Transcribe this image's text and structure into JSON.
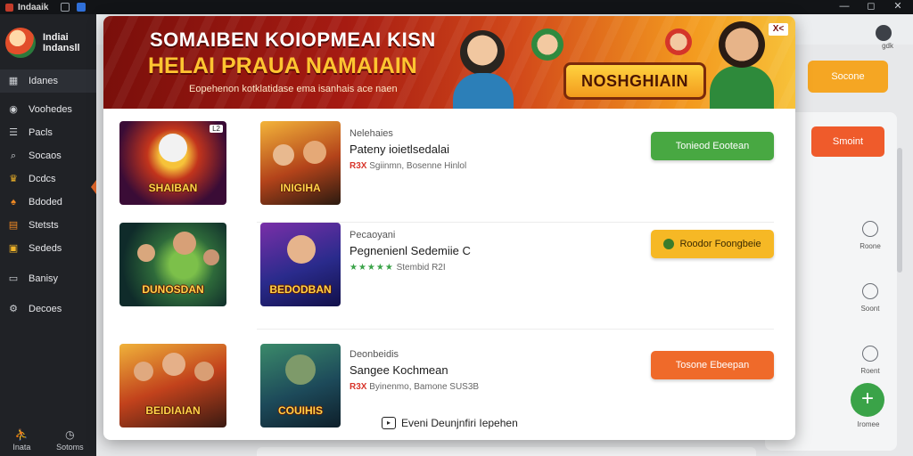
{
  "window": {
    "title": "Indaaik",
    "controls": [
      "—",
      "◻",
      "✕"
    ]
  },
  "sidebar": {
    "brand": [
      "Indiai",
      "Indansll"
    ],
    "items": [
      {
        "label": "Idanes",
        "icon": "grid-icon"
      },
      {
        "label": "Voohedes",
        "icon": "circle-icon"
      },
      {
        "label": "Pacls",
        "icon": "list-icon"
      },
      {
        "label": "Socaos",
        "icon": "search-icon"
      },
      {
        "label": "Dcdcs",
        "icon": "trophy-icon"
      },
      {
        "label": "Bdoded",
        "icon": "bell-icon"
      },
      {
        "label": "Stetsts",
        "icon": "stats-icon"
      },
      {
        "label": "Sededs",
        "icon": "gift-icon"
      },
      {
        "label": "Banisy",
        "icon": "card-icon"
      },
      {
        "label": "Decoes",
        "icon": "settings-icon"
      }
    ],
    "bottom": [
      {
        "label": "Inata",
        "icon": "person-icon"
      },
      {
        "label": "Sotoms",
        "icon": "clock-icon"
      }
    ]
  },
  "background": {
    "avatar_label": "gdk",
    "button_top": "Socone",
    "button_second": "Smoint",
    "side_icons": [
      {
        "label": "Roone",
        "icon": "refresh-icon"
      },
      {
        "label": "Soont",
        "icon": "check-circle-icon"
      },
      {
        "label": "Roent",
        "icon": "check-icon"
      }
    ],
    "fab_label": "Iromee"
  },
  "modal": {
    "banner": {
      "title": "SOMAIBEN KOIOPMEAI KISN",
      "subtitle": "HELAI PRAUA NAMAIAIN",
      "tagline": "Eopehenon kotklatidase ema isanhais ace naen",
      "logo_text": "NOSHGHIAIN",
      "close_label": "X<"
    },
    "games": [
      {
        "thumb1_label": "SHAIBAN",
        "thumb1_tag": "L2",
        "thumb2_label": "INIGIHA",
        "category": "Nelehaies",
        "name": "Pateny ioietlsedalai",
        "meta_hot": "R3X",
        "meta_text": "Sgiinmn, Bosenne Hinlol",
        "action": "Tonieod Eootean",
        "action_color": "green"
      },
      {
        "thumb1_label": "DUNOSDAN",
        "thumb2_label": "BEDODBAN",
        "category": "Pecaoyani",
        "name": "Pegnenienl Sedemiie C",
        "meta_stars": "★★★★★",
        "meta_text": "Stembid R2I",
        "action": "Roodor Foongbeie",
        "action_color": "yellow"
      },
      {
        "thumb1_label": "BEIDIAIAN",
        "thumb2_label": "COUIHIS",
        "category": "Deonbeidis",
        "name": "Sangee Kochmean",
        "meta_hot": "R3X",
        "meta_text": "Byinenmo, Bamone SUS3B",
        "action": "Tosone Ebeepan",
        "action_color": "orange"
      }
    ],
    "footer_link": "Eveni Deunjnfiri Iepehen"
  }
}
